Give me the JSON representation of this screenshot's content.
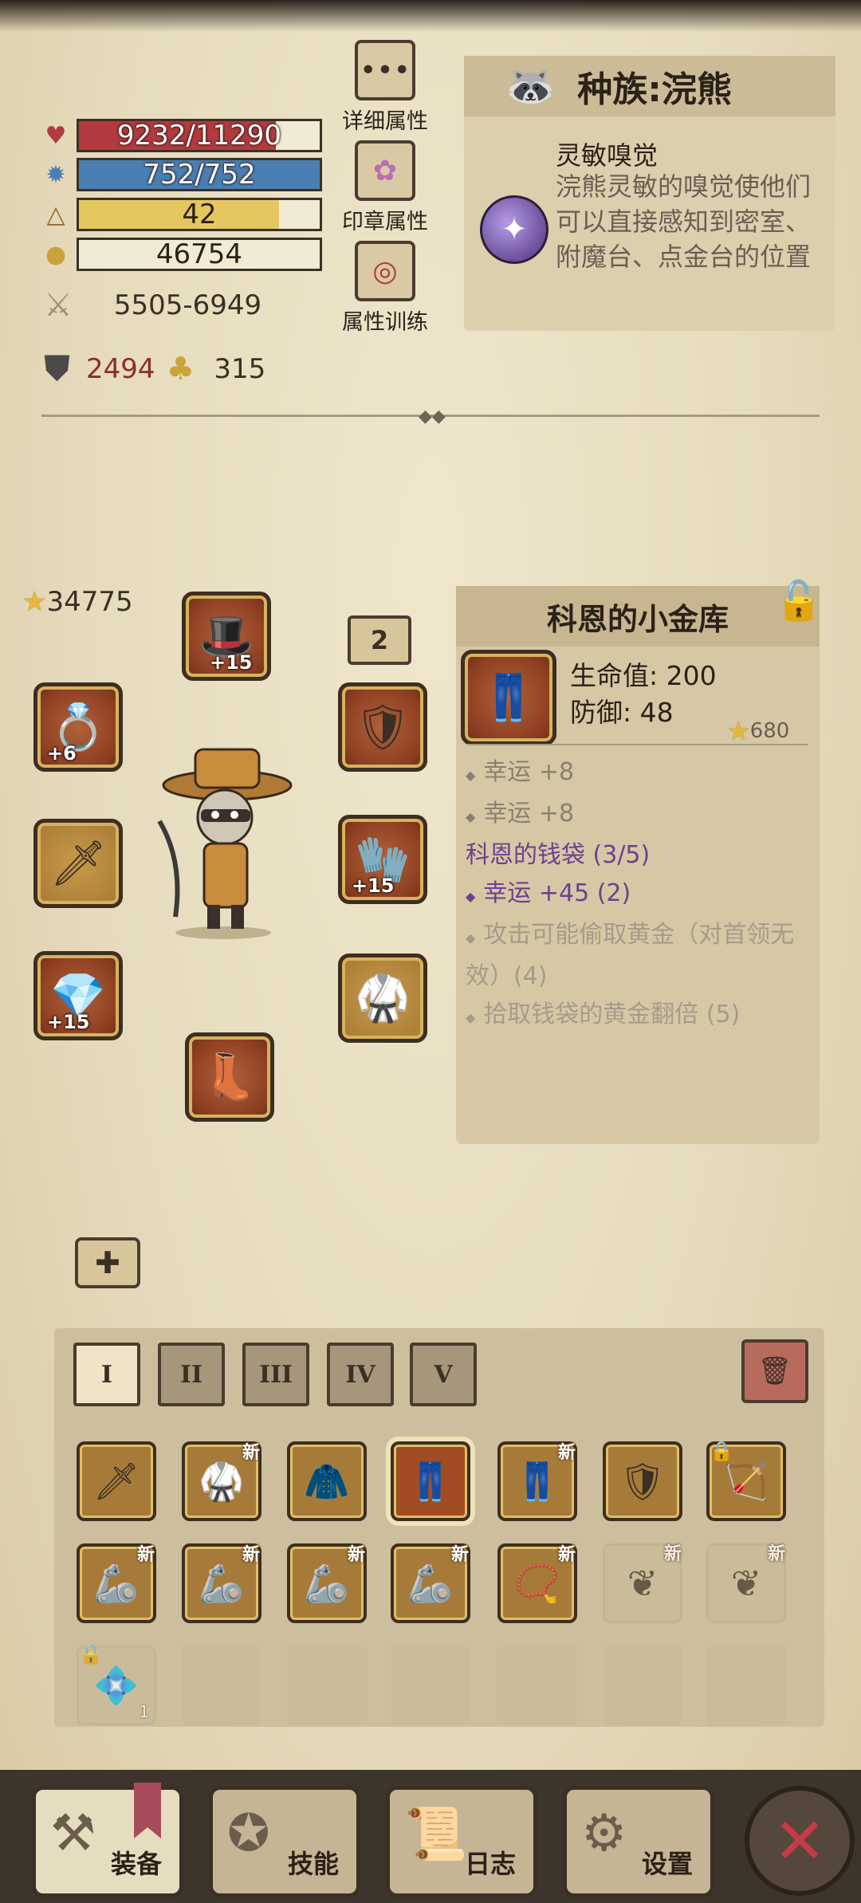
{
  "stats": {
    "hp": {
      "text": "9232/11290",
      "fraction": 0.818,
      "color": "#b23b3f"
    },
    "mana": {
      "text": "752/752",
      "fraction": 1.0,
      "color": "#4a7fb4"
    },
    "level": {
      "text": "42",
      "fraction": 0.83,
      "color": "#e6c75f"
    },
    "gold": {
      "text": "46754"
    },
    "damage": "5505-6949",
    "armor": "2494",
    "luck": "315"
  },
  "side_buttons": {
    "details": "详细属性",
    "seal": "印章属性",
    "training": "属性训练"
  },
  "race": {
    "title": "种族:浣熊",
    "skill_name": "灵敏嗅觉",
    "skill_desc": "浣熊灵敏的嗅觉使他们可以直接感知到密室、附魔台、点金台的位置"
  },
  "equipment": {
    "score": "34775",
    "page": "2",
    "plus": {
      "head": "+15",
      "ring": "+6",
      "gloves": "+15",
      "amulet": "+15"
    }
  },
  "tooltip": {
    "title": "科恩的小金库",
    "main_stats": [
      "生命值: 200",
      "防御: 48"
    ],
    "item_score": "680",
    "lines": [
      {
        "text": "幸运 +8",
        "kind": "gray",
        "bullet": true
      },
      {
        "text": "幸运 +8",
        "kind": "gray",
        "bullet": true
      },
      {
        "text": "科恩的钱袋 (3/5)",
        "kind": "purple",
        "bullet": false
      },
      {
        "text": "幸运 +45 (2)",
        "kind": "purple",
        "bullet": true
      },
      {
        "text": "攻击可能偷取黄金（对首领无效）(4)",
        "kind": "dim",
        "bullet": true
      },
      {
        "text": "拾取钱袋的黄金翻倍 (5)",
        "kind": "dim",
        "bullet": true
      }
    ]
  },
  "inventory": {
    "tabs": [
      "I",
      "II",
      "III",
      "IV",
      "V"
    ],
    "new_label": "新",
    "stack_count": "1"
  },
  "nav": {
    "equipment": "装备",
    "skills": "技能",
    "log": "日志",
    "settings": "设置"
  },
  "icons": {
    "hp": "heart-icon",
    "mana": "mana-icon",
    "level": "triangle-icon",
    "gold": "coins-icon",
    "damage": "crossed-swords-icon",
    "armor": "shield-icon",
    "luck": "luck-icon",
    "close": "close-icon"
  }
}
